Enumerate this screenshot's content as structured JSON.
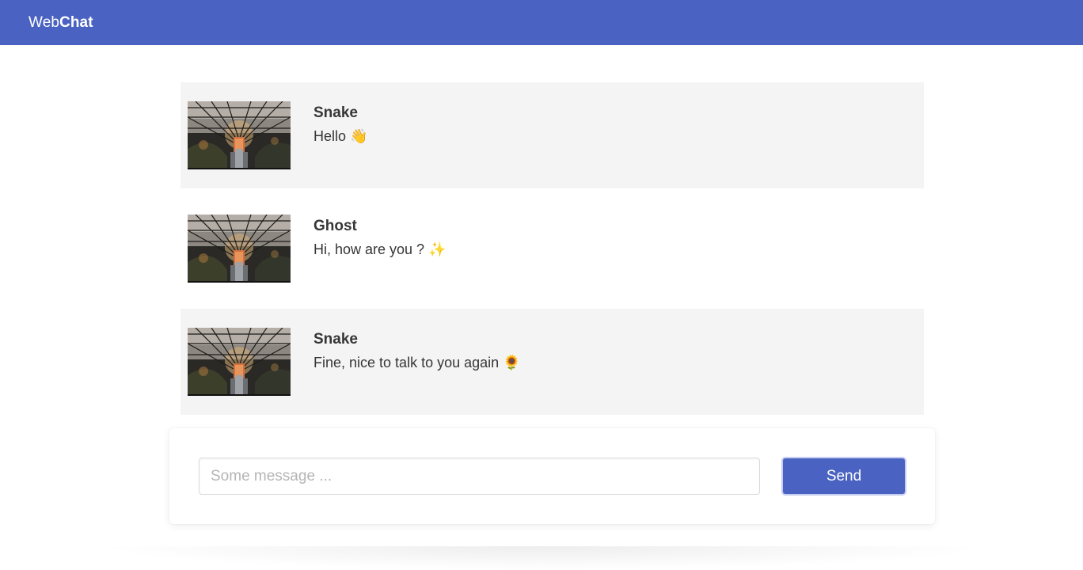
{
  "navbar": {
    "brand_light": "Web",
    "brand_bold": "Chat"
  },
  "messages": [
    {
      "author": "Snake",
      "text": "Hello 👋",
      "avatar_icon": "greenhouse-photo"
    },
    {
      "author": "Ghost",
      "text": "Hi, how are you ? ✨",
      "avatar_icon": "greenhouse-photo"
    },
    {
      "author": "Snake",
      "text": "Fine, nice to talk to you again 🌻",
      "avatar_icon": "greenhouse-photo"
    }
  ],
  "composer": {
    "placeholder": "Some message ...",
    "value": "",
    "send_label": "Send"
  },
  "colors": {
    "primary": "#4a62c1",
    "shaded_row": "#f4f4f4"
  }
}
